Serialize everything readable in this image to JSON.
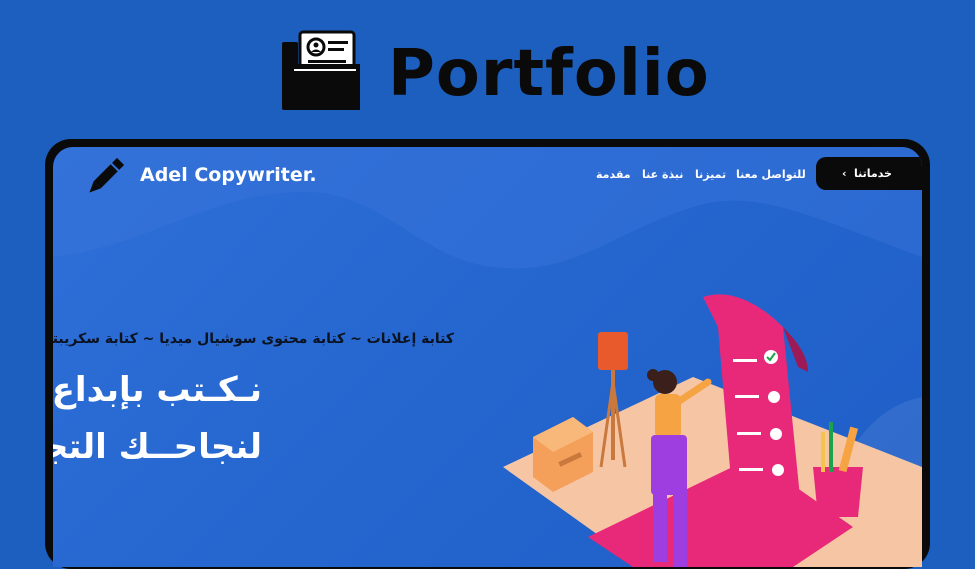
{
  "header": {
    "title": "Portfolio",
    "icon": "portfolio-folder-icon"
  },
  "site": {
    "brand": "Adel Copywriter.",
    "logo_icon": "pen-icon",
    "nav": {
      "intro": "مقدمة",
      "about": "نبذة عنا",
      "features": "تميزنا",
      "contact": "للتواصل معنا",
      "services": "خدماتنا",
      "services_chevron": "‹"
    },
    "hero": {
      "tagline": "كتابة إعلانات ~ كتابة محتوى سوشيال ميديا ~ كتابة سكريبتات يوتيوب",
      "line1": "نـكـتب بإبداع",
      "line2": "لنجاحــك التجـــاري"
    }
  },
  "colors": {
    "background": "#1d5fbe",
    "frame": "#0a0a0a",
    "screen": "#2566cf",
    "accent_pink": "#e8297a",
    "peach": "#f6c6a4"
  }
}
